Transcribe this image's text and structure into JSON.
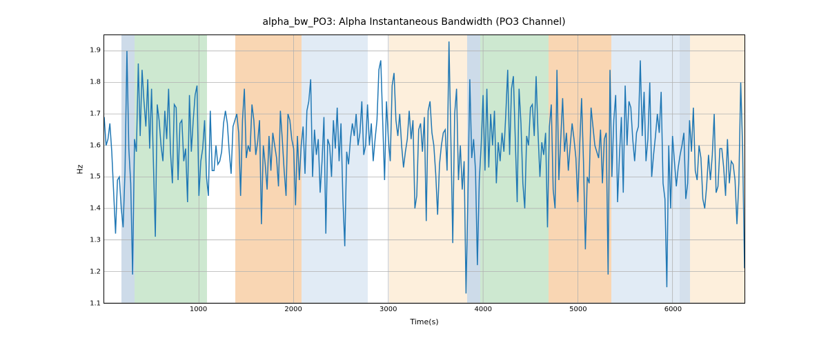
{
  "chart_data": {
    "type": "line",
    "title": "alpha_bw_PO3: Alpha Instantaneous Bandwidth (PO3 Channel)",
    "xlabel": "Time(s)",
    "ylabel": "Hz",
    "xlim": [
      0,
      6760
    ],
    "ylim": [
      1.1,
      1.95
    ],
    "xticks": [
      1000,
      2000,
      3000,
      4000,
      5000,
      6000
    ],
    "yticks": [
      1.1,
      1.2,
      1.3,
      1.4,
      1.5,
      1.6,
      1.7,
      1.8,
      1.9
    ],
    "bands": [
      {
        "x0": 180,
        "x1": 320,
        "color": "#b8cce0",
        "alpha": 0.7
      },
      {
        "x0": 320,
        "x1": 1080,
        "color": "#c0e2c4",
        "alpha": 0.8
      },
      {
        "x0": 1380,
        "x1": 2080,
        "color": "#f7c89a",
        "alpha": 0.75
      },
      {
        "x0": 2080,
        "x1": 2780,
        "color": "#d9e6f2",
        "alpha": 0.8
      },
      {
        "x0": 3000,
        "x1": 3820,
        "color": "#fdebd3",
        "alpha": 0.8
      },
      {
        "x0": 3820,
        "x1": 3960,
        "color": "#b8cce0",
        "alpha": 0.7
      },
      {
        "x0": 3960,
        "x1": 4680,
        "color": "#c0e2c4",
        "alpha": 0.8
      },
      {
        "x0": 4680,
        "x1": 5340,
        "color": "#f7c89a",
        "alpha": 0.75
      },
      {
        "x0": 5340,
        "x1": 6060,
        "color": "#d9e6f2",
        "alpha": 0.8
      },
      {
        "x0": 6060,
        "x1": 6170,
        "color": "#b8cce0",
        "alpha": 0.6
      },
      {
        "x0": 6170,
        "x1": 6760,
        "color": "#fdebd3",
        "alpha": 0.8
      }
    ],
    "line_color": "#1f77b4",
    "line_width": 1.5,
    "x": [
      0,
      20,
      40,
      60,
      80,
      100,
      120,
      140,
      160,
      180,
      200,
      220,
      240,
      260,
      280,
      300,
      320,
      340,
      360,
      380,
      400,
      420,
      440,
      460,
      480,
      500,
      520,
      540,
      560,
      580,
      600,
      620,
      640,
      660,
      680,
      700,
      720,
      740,
      760,
      780,
      800,
      820,
      840,
      860,
      880,
      900,
      920,
      940,
      960,
      980,
      1000,
      1020,
      1040,
      1060,
      1080,
      1100,
      1120,
      1140,
      1160,
      1180,
      1200,
      1220,
      1240,
      1260,
      1280,
      1300,
      1320,
      1340,
      1360,
      1380,
      1400,
      1420,
      1440,
      1460,
      1480,
      1500,
      1520,
      1540,
      1560,
      1580,
      1600,
      1620,
      1640,
      1660,
      1680,
      1700,
      1720,
      1740,
      1760,
      1780,
      1800,
      1820,
      1840,
      1860,
      1880,
      1900,
      1920,
      1940,
      1960,
      1980,
      2000,
      2020,
      2040,
      2060,
      2080,
      2100,
      2120,
      2140,
      2160,
      2180,
      2200,
      2220,
      2240,
      2260,
      2280,
      2300,
      2320,
      2340,
      2360,
      2380,
      2400,
      2420,
      2440,
      2460,
      2480,
      2500,
      2520,
      2540,
      2560,
      2580,
      2600,
      2620,
      2640,
      2660,
      2680,
      2700,
      2720,
      2740,
      2760,
      2780,
      2800,
      2820,
      2840,
      2860,
      2880,
      2900,
      2920,
      2940,
      2960,
      2980,
      3000,
      3020,
      3040,
      3060,
      3080,
      3100,
      3120,
      3140,
      3160,
      3180,
      3200,
      3220,
      3240,
      3260,
      3280,
      3300,
      3320,
      3340,
      3360,
      3380,
      3400,
      3420,
      3440,
      3460,
      3480,
      3500,
      3520,
      3540,
      3560,
      3580,
      3600,
      3620,
      3640,
      3660,
      3680,
      3700,
      3720,
      3740,
      3760,
      3780,
      3800,
      3820,
      3840,
      3860,
      3880,
      3900,
      3920,
      3940,
      3960,
      3980,
      4000,
      4020,
      4040,
      4060,
      4080,
      4100,
      4120,
      4140,
      4160,
      4180,
      4200,
      4220,
      4240,
      4260,
      4280,
      4300,
      4320,
      4340,
      4360,
      4380,
      4400,
      4420,
      4440,
      4460,
      4480,
      4500,
      4520,
      4540,
      4560,
      4580,
      4600,
      4620,
      4640,
      4660,
      4680,
      4700,
      4720,
      4740,
      4760,
      4780,
      4800,
      4820,
      4840,
      4860,
      4880,
      4900,
      4920,
      4940,
      4960,
      4980,
      5000,
      5020,
      5040,
      5060,
      5080,
      5100,
      5120,
      5140,
      5160,
      5180,
      5200,
      5220,
      5240,
      5260,
      5280,
      5300,
      5320,
      5340,
      5360,
      5380,
      5400,
      5420,
      5440,
      5460,
      5480,
      5500,
      5520,
      5540,
      5560,
      5580,
      5600,
      5620,
      5640,
      5660,
      5680,
      5700,
      5720,
      5740,
      5760,
      5780,
      5800,
      5820,
      5840,
      5860,
      5880,
      5900,
      5920,
      5940,
      5960,
      5980,
      6000,
      6020,
      6040,
      6060,
      6080,
      6100,
      6120,
      6140,
      6160,
      6180,
      6200,
      6220,
      6240,
      6260,
      6280,
      6300,
      6320,
      6340,
      6360,
      6380,
      6400,
      6420,
      6440,
      6460,
      6480,
      6500,
      6520,
      6540,
      6560,
      6580,
      6600,
      6620,
      6640,
      6660,
      6680,
      6700,
      6720,
      6740,
      6760
    ],
    "y": [
      1.69,
      1.6,
      1.62,
      1.67,
      1.58,
      1.45,
      1.32,
      1.49,
      1.5,
      1.4,
      1.34,
      1.52,
      1.9,
      1.59,
      1.48,
      1.19,
      1.62,
      1.58,
      1.86,
      1.63,
      1.84,
      1.74,
      1.66,
      1.81,
      1.59,
      1.78,
      1.54,
      1.31,
      1.73,
      1.68,
      1.6,
      1.55,
      1.71,
      1.62,
      1.78,
      1.58,
      1.48,
      1.73,
      1.72,
      1.49,
      1.67,
      1.68,
      1.55,
      1.59,
      1.42,
      1.76,
      1.58,
      1.68,
      1.76,
      1.79,
      1.44,
      1.55,
      1.59,
      1.68,
      1.5,
      1.44,
      1.71,
      1.52,
      1.52,
      1.6,
      1.54,
      1.55,
      1.58,
      1.67,
      1.71,
      1.67,
      1.58,
      1.51,
      1.66,
      1.68,
      1.7,
      1.64,
      1.44,
      1.68,
      1.78,
      1.56,
      1.6,
      1.58,
      1.73,
      1.68,
      1.57,
      1.61,
      1.68,
      1.35,
      1.6,
      1.54,
      1.46,
      1.63,
      1.52,
      1.64,
      1.6,
      1.56,
      1.47,
      1.71,
      1.62,
      1.52,
      1.44,
      1.7,
      1.68,
      1.62,
      1.59,
      1.41,
      1.63,
      1.49,
      1.6,
      1.66,
      1.51,
      1.71,
      1.74,
      1.81,
      1.5,
      1.65,
      1.57,
      1.62,
      1.45,
      1.55,
      1.69,
      1.32,
      1.62,
      1.6,
      1.5,
      1.68,
      1.59,
      1.72,
      1.55,
      1.67,
      1.43,
      1.28,
      1.58,
      1.54,
      1.62,
      1.67,
      1.63,
      1.7,
      1.6,
      1.64,
      1.74,
      1.57,
      1.6,
      1.73,
      1.6,
      1.67,
      1.55,
      1.62,
      1.68,
      1.84,
      1.87,
      1.68,
      1.49,
      1.74,
      1.62,
      1.55,
      1.79,
      1.83,
      1.68,
      1.63,
      1.7,
      1.6,
      1.53,
      1.58,
      1.62,
      1.71,
      1.62,
      1.68,
      1.4,
      1.44,
      1.65,
      1.67,
      1.58,
      1.69,
      1.36,
      1.71,
      1.74,
      1.64,
      1.6,
      1.51,
      1.38,
      1.54,
      1.6,
      1.64,
      1.65,
      1.52,
      1.93,
      1.62,
      1.29,
      1.7,
      1.78,
      1.49,
      1.6,
      1.46,
      1.55,
      1.13,
      1.44,
      1.81,
      1.56,
      1.62,
      1.52,
      1.22,
      1.49,
      1.6,
      1.76,
      1.52,
      1.78,
      1.53,
      1.7,
      1.6,
      1.71,
      1.48,
      1.61,
      1.55,
      1.64,
      1.58,
      1.7,
      1.84,
      1.57,
      1.78,
      1.82,
      1.62,
      1.42,
      1.78,
      1.67,
      1.48,
      1.4,
      1.63,
      1.6,
      1.72,
      1.73,
      1.63,
      1.82,
      1.64,
      1.5,
      1.61,
      1.57,
      1.64,
      1.34,
      1.66,
      1.73,
      1.46,
      1.4,
      1.84,
      1.49,
      1.62,
      1.75,
      1.58,
      1.64,
      1.52,
      1.6,
      1.67,
      1.62,
      1.56,
      1.42,
      1.6,
      1.75,
      1.55,
      1.27,
      1.5,
      1.48,
      1.72,
      1.66,
      1.6,
      1.58,
      1.56,
      1.65,
      1.48,
      1.62,
      1.64,
      1.19,
      1.84,
      1.5,
      1.68,
      1.76,
      1.42,
      1.57,
      1.69,
      1.45,
      1.79,
      1.6,
      1.74,
      1.72,
      1.62,
      1.55,
      1.64,
      1.66,
      1.87,
      1.63,
      1.77,
      1.55,
      1.62,
      1.8,
      1.5,
      1.57,
      1.63,
      1.7,
      1.64,
      1.77,
      1.48,
      1.43,
      1.15,
      1.6,
      1.4,
      1.63,
      1.55,
      1.47,
      1.53,
      1.57,
      1.6,
      1.64,
      1.43,
      1.48,
      1.68,
      1.58,
      1.72,
      1.52,
      1.49,
      1.6,
      1.56,
      1.43,
      1.4,
      1.47,
      1.57,
      1.49,
      1.57,
      1.7,
      1.45,
      1.47,
      1.59,
      1.59,
      1.53,
      1.44,
      1.62,
      1.48,
      1.55,
      1.54,
      1.49,
      1.35,
      1.48,
      1.8,
      1.59,
      1.21
    ]
  }
}
